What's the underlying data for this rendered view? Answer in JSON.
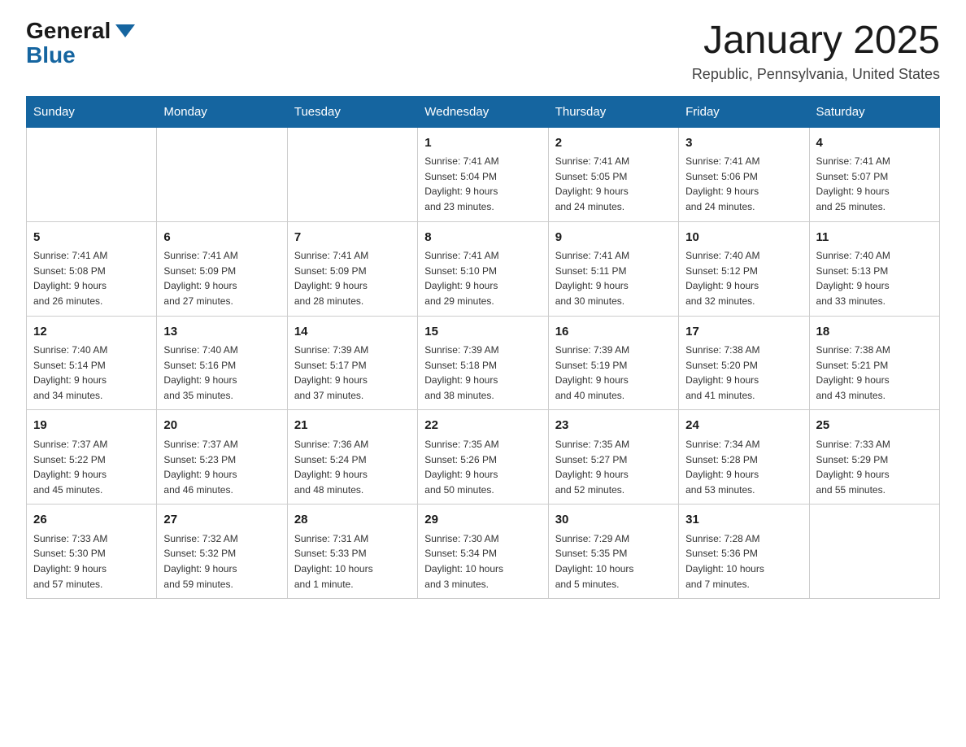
{
  "header": {
    "logo_general": "General",
    "logo_blue": "Blue",
    "title": "January 2025",
    "subtitle": "Republic, Pennsylvania, United States"
  },
  "days_of_week": [
    "Sunday",
    "Monday",
    "Tuesday",
    "Wednesday",
    "Thursday",
    "Friday",
    "Saturday"
  ],
  "weeks": [
    [
      {
        "day": "",
        "info": ""
      },
      {
        "day": "",
        "info": ""
      },
      {
        "day": "",
        "info": ""
      },
      {
        "day": "1",
        "info": "Sunrise: 7:41 AM\nSunset: 5:04 PM\nDaylight: 9 hours\nand 23 minutes."
      },
      {
        "day": "2",
        "info": "Sunrise: 7:41 AM\nSunset: 5:05 PM\nDaylight: 9 hours\nand 24 minutes."
      },
      {
        "day": "3",
        "info": "Sunrise: 7:41 AM\nSunset: 5:06 PM\nDaylight: 9 hours\nand 24 minutes."
      },
      {
        "day": "4",
        "info": "Sunrise: 7:41 AM\nSunset: 5:07 PM\nDaylight: 9 hours\nand 25 minutes."
      }
    ],
    [
      {
        "day": "5",
        "info": "Sunrise: 7:41 AM\nSunset: 5:08 PM\nDaylight: 9 hours\nand 26 minutes."
      },
      {
        "day": "6",
        "info": "Sunrise: 7:41 AM\nSunset: 5:09 PM\nDaylight: 9 hours\nand 27 minutes."
      },
      {
        "day": "7",
        "info": "Sunrise: 7:41 AM\nSunset: 5:09 PM\nDaylight: 9 hours\nand 28 minutes."
      },
      {
        "day": "8",
        "info": "Sunrise: 7:41 AM\nSunset: 5:10 PM\nDaylight: 9 hours\nand 29 minutes."
      },
      {
        "day": "9",
        "info": "Sunrise: 7:41 AM\nSunset: 5:11 PM\nDaylight: 9 hours\nand 30 minutes."
      },
      {
        "day": "10",
        "info": "Sunrise: 7:40 AM\nSunset: 5:12 PM\nDaylight: 9 hours\nand 32 minutes."
      },
      {
        "day": "11",
        "info": "Sunrise: 7:40 AM\nSunset: 5:13 PM\nDaylight: 9 hours\nand 33 minutes."
      }
    ],
    [
      {
        "day": "12",
        "info": "Sunrise: 7:40 AM\nSunset: 5:14 PM\nDaylight: 9 hours\nand 34 minutes."
      },
      {
        "day": "13",
        "info": "Sunrise: 7:40 AM\nSunset: 5:16 PM\nDaylight: 9 hours\nand 35 minutes."
      },
      {
        "day": "14",
        "info": "Sunrise: 7:39 AM\nSunset: 5:17 PM\nDaylight: 9 hours\nand 37 minutes."
      },
      {
        "day": "15",
        "info": "Sunrise: 7:39 AM\nSunset: 5:18 PM\nDaylight: 9 hours\nand 38 minutes."
      },
      {
        "day": "16",
        "info": "Sunrise: 7:39 AM\nSunset: 5:19 PM\nDaylight: 9 hours\nand 40 minutes."
      },
      {
        "day": "17",
        "info": "Sunrise: 7:38 AM\nSunset: 5:20 PM\nDaylight: 9 hours\nand 41 minutes."
      },
      {
        "day": "18",
        "info": "Sunrise: 7:38 AM\nSunset: 5:21 PM\nDaylight: 9 hours\nand 43 minutes."
      }
    ],
    [
      {
        "day": "19",
        "info": "Sunrise: 7:37 AM\nSunset: 5:22 PM\nDaylight: 9 hours\nand 45 minutes."
      },
      {
        "day": "20",
        "info": "Sunrise: 7:37 AM\nSunset: 5:23 PM\nDaylight: 9 hours\nand 46 minutes."
      },
      {
        "day": "21",
        "info": "Sunrise: 7:36 AM\nSunset: 5:24 PM\nDaylight: 9 hours\nand 48 minutes."
      },
      {
        "day": "22",
        "info": "Sunrise: 7:35 AM\nSunset: 5:26 PM\nDaylight: 9 hours\nand 50 minutes."
      },
      {
        "day": "23",
        "info": "Sunrise: 7:35 AM\nSunset: 5:27 PM\nDaylight: 9 hours\nand 52 minutes."
      },
      {
        "day": "24",
        "info": "Sunrise: 7:34 AM\nSunset: 5:28 PM\nDaylight: 9 hours\nand 53 minutes."
      },
      {
        "day": "25",
        "info": "Sunrise: 7:33 AM\nSunset: 5:29 PM\nDaylight: 9 hours\nand 55 minutes."
      }
    ],
    [
      {
        "day": "26",
        "info": "Sunrise: 7:33 AM\nSunset: 5:30 PM\nDaylight: 9 hours\nand 57 minutes."
      },
      {
        "day": "27",
        "info": "Sunrise: 7:32 AM\nSunset: 5:32 PM\nDaylight: 9 hours\nand 59 minutes."
      },
      {
        "day": "28",
        "info": "Sunrise: 7:31 AM\nSunset: 5:33 PM\nDaylight: 10 hours\nand 1 minute."
      },
      {
        "day": "29",
        "info": "Sunrise: 7:30 AM\nSunset: 5:34 PM\nDaylight: 10 hours\nand 3 minutes."
      },
      {
        "day": "30",
        "info": "Sunrise: 7:29 AM\nSunset: 5:35 PM\nDaylight: 10 hours\nand 5 minutes."
      },
      {
        "day": "31",
        "info": "Sunrise: 7:28 AM\nSunset: 5:36 PM\nDaylight: 10 hours\nand 7 minutes."
      },
      {
        "day": "",
        "info": ""
      }
    ]
  ]
}
